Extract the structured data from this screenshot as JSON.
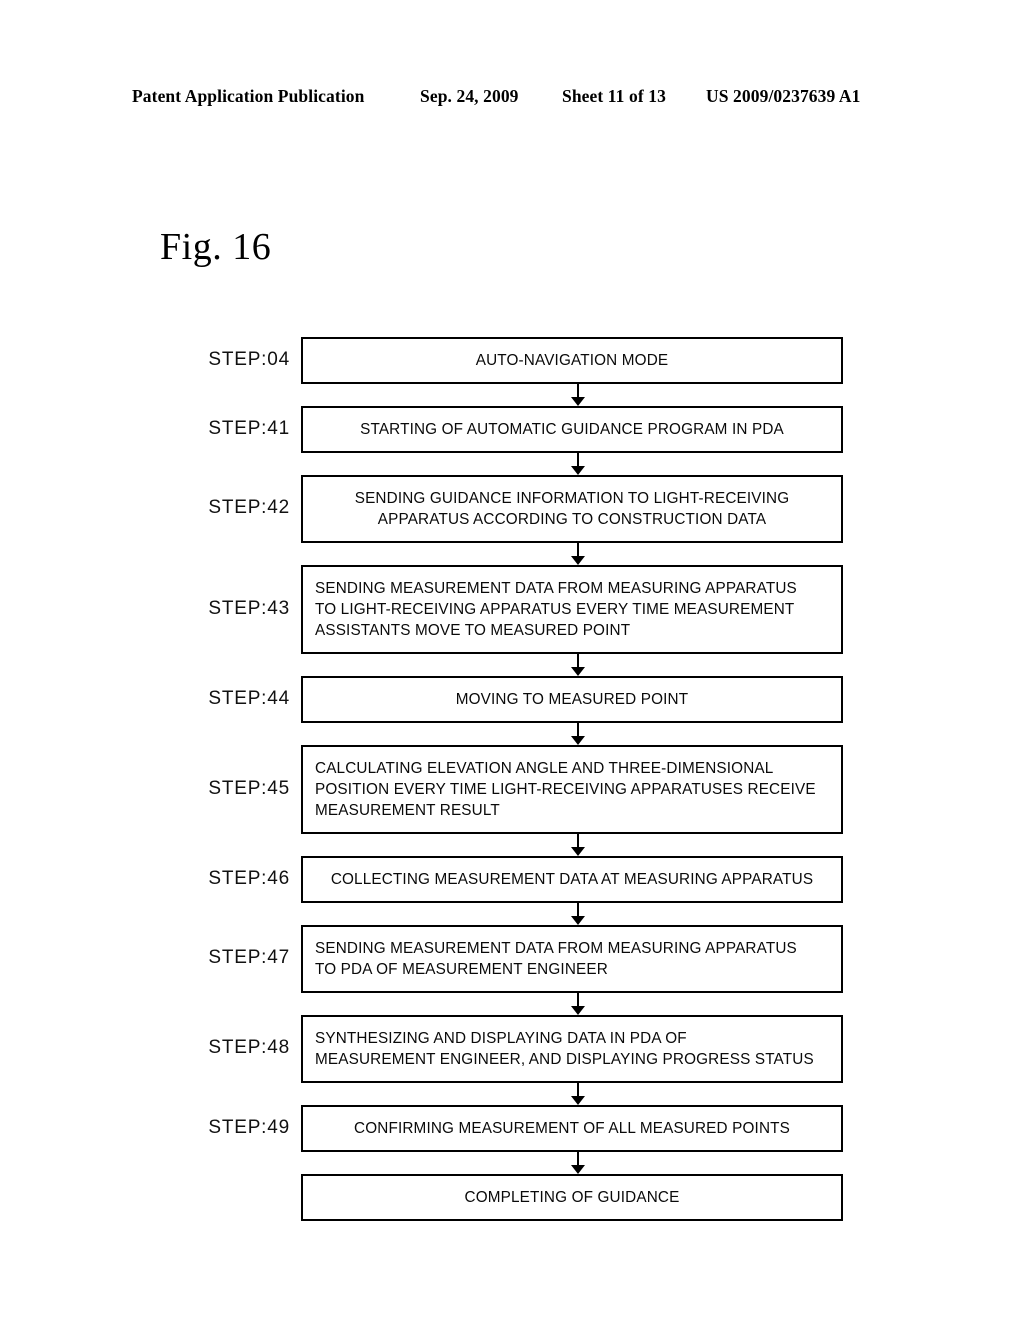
{
  "header": {
    "publication": "Patent Application Publication",
    "date": "Sep. 24, 2009",
    "sheet": "Sheet 11 of 13",
    "patent_number": "US 2009/0237639 A1"
  },
  "figure": {
    "title": "Fig. 16"
  },
  "flowchart": {
    "orientation": "vertical",
    "connector": "down-arrow",
    "steps": [
      {
        "label": "STEP:04",
        "text": "AUTO-NAVIGATION MODE",
        "align": "center",
        "lines": 1
      },
      {
        "label": "STEP:41",
        "text": "STARTING OF AUTOMATIC GUIDANCE PROGRAM IN PDA",
        "align": "center",
        "lines": 1
      },
      {
        "label": "STEP:42",
        "text": "SENDING GUIDANCE INFORMATION TO LIGHT-RECEIVING\nAPPARATUS ACCORDING TO CONSTRUCTION DATA",
        "align": "block-center",
        "lines": 2
      },
      {
        "label": "STEP:43",
        "text": "SENDING MEASUREMENT DATA FROM MEASURING APPARATUS\nTO LIGHT-RECEIVING APPARATUS EVERY TIME MEASUREMENT\nASSISTANTS MOVE TO MEASURED POINT",
        "align": "left",
        "lines": 3
      },
      {
        "label": "STEP:44",
        "text": "MOVING TO MEASURED POINT",
        "align": "center",
        "lines": 1
      },
      {
        "label": "STEP:45",
        "text": "CALCULATING ELEVATION ANGLE AND THREE-DIMENSIONAL\nPOSITION EVERY TIME LIGHT-RECEIVING APPARATUSES RECEIVE\nMEASUREMENT RESULT",
        "align": "left",
        "lines": 3
      },
      {
        "label": "STEP:46",
        "text": "COLLECTING MEASUREMENT DATA AT MEASURING APPARATUS",
        "align": "center",
        "lines": 1
      },
      {
        "label": "STEP:47",
        "text": "SENDING MEASUREMENT DATA FROM MEASURING APPARATUS\nTO PDA OF MEASUREMENT ENGINEER",
        "align": "left",
        "lines": 2
      },
      {
        "label": "STEP:48",
        "text": "SYNTHESIZING AND DISPLAYING DATA IN PDA OF\nMEASUREMENT ENGINEER, AND DISPLAYING PROGRESS STATUS",
        "align": "left",
        "lines": 2
      },
      {
        "label": "STEP:49",
        "text": "CONFIRMING MEASUREMENT OF ALL MEASURED POINTS",
        "align": "center",
        "lines": 1
      },
      {
        "label": "",
        "text": "COMPLETING OF GUIDANCE",
        "align": "center",
        "lines": 1
      }
    ]
  },
  "colors": {
    "ink": "#000000",
    "paper": "#ffffff"
  }
}
